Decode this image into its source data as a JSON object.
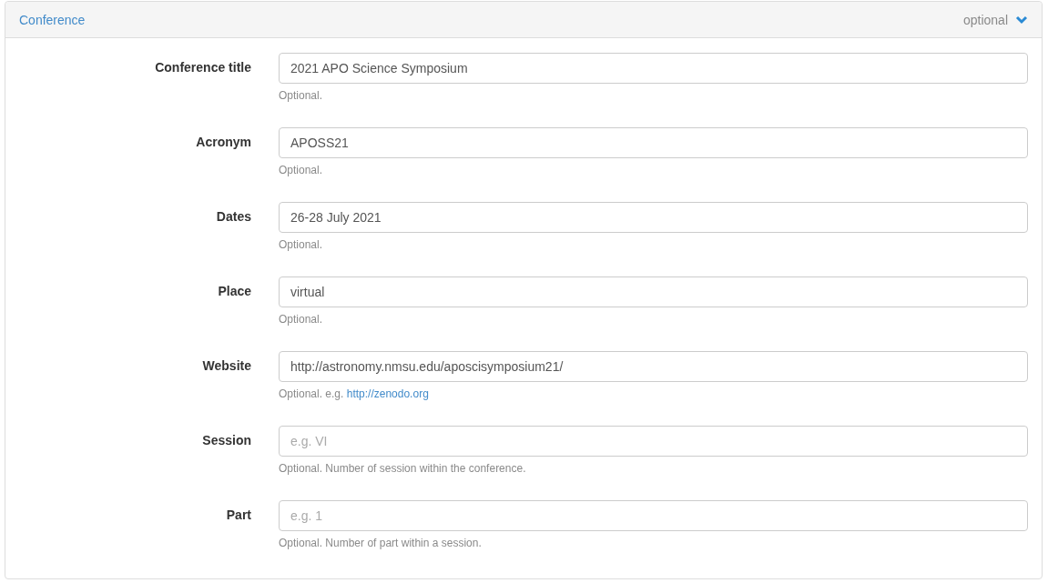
{
  "panel": {
    "title": "Conference",
    "badge": "optional",
    "expanded": true
  },
  "fields": [
    {
      "label": "Conference title",
      "value": "2021 APO Science Symposium",
      "help": "Optional."
    },
    {
      "label": "Acronym",
      "value": "APOSS21",
      "help": "Optional."
    },
    {
      "label": "Dates",
      "value": "26-28 July 2021",
      "help": "Optional."
    },
    {
      "label": "Place",
      "value": "virtual",
      "help": "Optional."
    },
    {
      "label": "Website",
      "value": "http://astronomy.nmsu.edu/aposcisymposium21/",
      "help": "Optional. e.g.",
      "help_link": "http://zenodo.org"
    },
    {
      "label": "Session",
      "placeholder": "e.g. VI",
      "help": "Optional. Number of session within the conference."
    },
    {
      "label": "Part",
      "placeholder": "e.g. 1",
      "help": "Optional. Number of part within a session."
    }
  ]
}
